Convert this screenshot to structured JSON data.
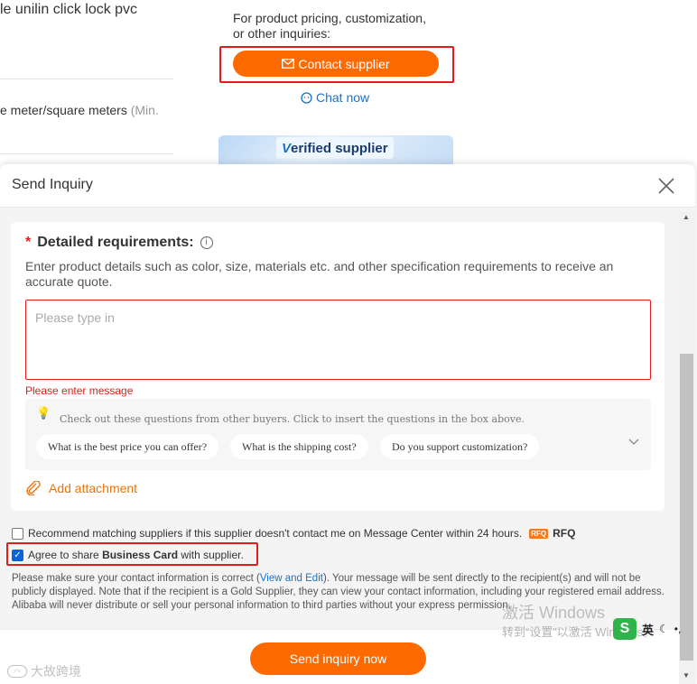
{
  "product": {
    "title_fragment": "le unilin click lock pvc",
    "unit_fragment": "e meter/square meters",
    "unit_muted": "(Min."
  },
  "supplier_panel": {
    "prompt_line1": "For product pricing, customization,",
    "prompt_line2": "or other inquiries:",
    "contact_label": "Contact supplier",
    "chat_label": "Chat now",
    "verified_v": "V",
    "verified_rest": "erified supplier"
  },
  "modal": {
    "title": "Send Inquiry",
    "requirements": {
      "required_mark": "*",
      "title": "Detailed requirements:",
      "info": "i",
      "description": "Enter product details such as color, size, materials etc. and other specification requirements to receive an accurate quote.",
      "placeholder": "Please type in",
      "error": "Please enter message",
      "questions_hint": "Check out these questions from other buyers. Click to insert the questions in the box above.",
      "questions": [
        "What is the best price you can offer?",
        "What is the shipping cost?",
        "Do you support customization?"
      ],
      "add_attachment": "Add attachment"
    },
    "options": {
      "recommend_label": "Recommend matching suppliers if this supplier doesn't contact me on Message Center within 24 hours.",
      "rfq_badge": "RFQ",
      "rfq_text": "RFQ",
      "recommend_checked": false,
      "share_prefix": "Agree to share ",
      "share_bold": "Business Card",
      "share_suffix": " with supplier.",
      "share_checked": true
    },
    "disclaimer": {
      "part1": "Please make sure your contact information is correct (",
      "link": "View and Edit",
      "part2": "). Your message will be sent directly to the recipient(s) and will not be publicly displayed. Note that if the recipient is a Gold Supplier, they can view your contact information, including your registered email address. Alibaba will never distribute or sell your personal information to third parties without your express permission."
    },
    "send_label": "Send inquiry now"
  },
  "overlays": {
    "windows_watermark": "激活 Windows",
    "windows_sub": "转到“设置”以激活 Windows。",
    "ime_logo": "S",
    "ime_text": "英",
    "brand_text": "大故跨境"
  },
  "colors": {
    "accent": "#ff6a00",
    "highlight": "#e31c1c",
    "link": "#1a73c7"
  }
}
